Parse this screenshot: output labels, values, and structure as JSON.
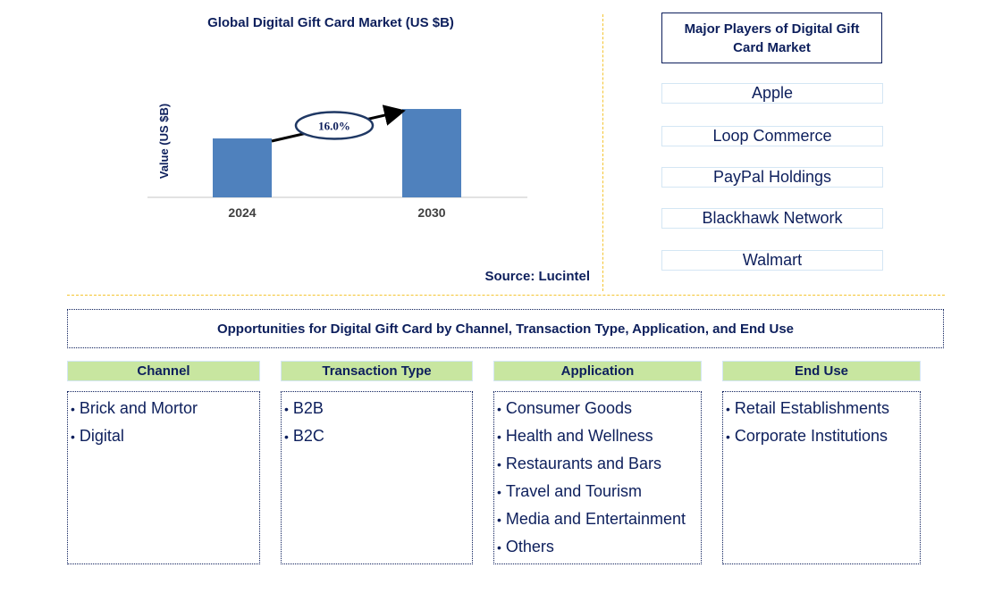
{
  "chart_data": {
    "type": "bar",
    "title": "Global Digital Gift Card Market (US $B)",
    "xlabel": "",
    "ylabel": "Value (US $B)",
    "categories": [
      "2024",
      "2030"
    ],
    "values": [
      2.0,
      3.0
    ],
    "ylim": [
      0,
      3.6
    ],
    "grid": false,
    "legend": "none",
    "annotations": [
      {
        "text": "16.0%",
        "type": "growth-arrow",
        "from": "2024",
        "to": "2030"
      }
    ],
    "bar_color": "#4f81bd"
  },
  "source": "Source: Lucintel",
  "players": {
    "title": "Major Players of Digital Gift Card Market",
    "items": [
      "Apple",
      "Loop Commerce",
      "PayPal Holdings",
      "Blackhawk Network",
      "Walmart"
    ]
  },
  "opportunities": {
    "title": "Opportunities for Digital Gift Card by Channel, Transaction Type, Application, and End Use",
    "categories": [
      {
        "heading": "Channel",
        "items": [
          "Brick and Mortor",
          "Digital"
        ]
      },
      {
        "heading": "Transaction Type",
        "items": [
          "B2B",
          "B2C"
        ]
      },
      {
        "heading": "Application",
        "items": [
          "Consumer Goods",
          "Health and Wellness",
          "Restaurants and Bars",
          "Travel and Tourism",
          "Media and Entertainment",
          "Others"
        ]
      },
      {
        "heading": "End Use",
        "items": [
          "Retail Establishments",
          "Corporate Institutions"
        ]
      }
    ]
  },
  "colors": {
    "text": "#0d1f5c",
    "bar": "#4f81bd",
    "divider": "#f4c430",
    "heading_fill": "#c8e6a0",
    "player_border": "#d4e6f4"
  }
}
